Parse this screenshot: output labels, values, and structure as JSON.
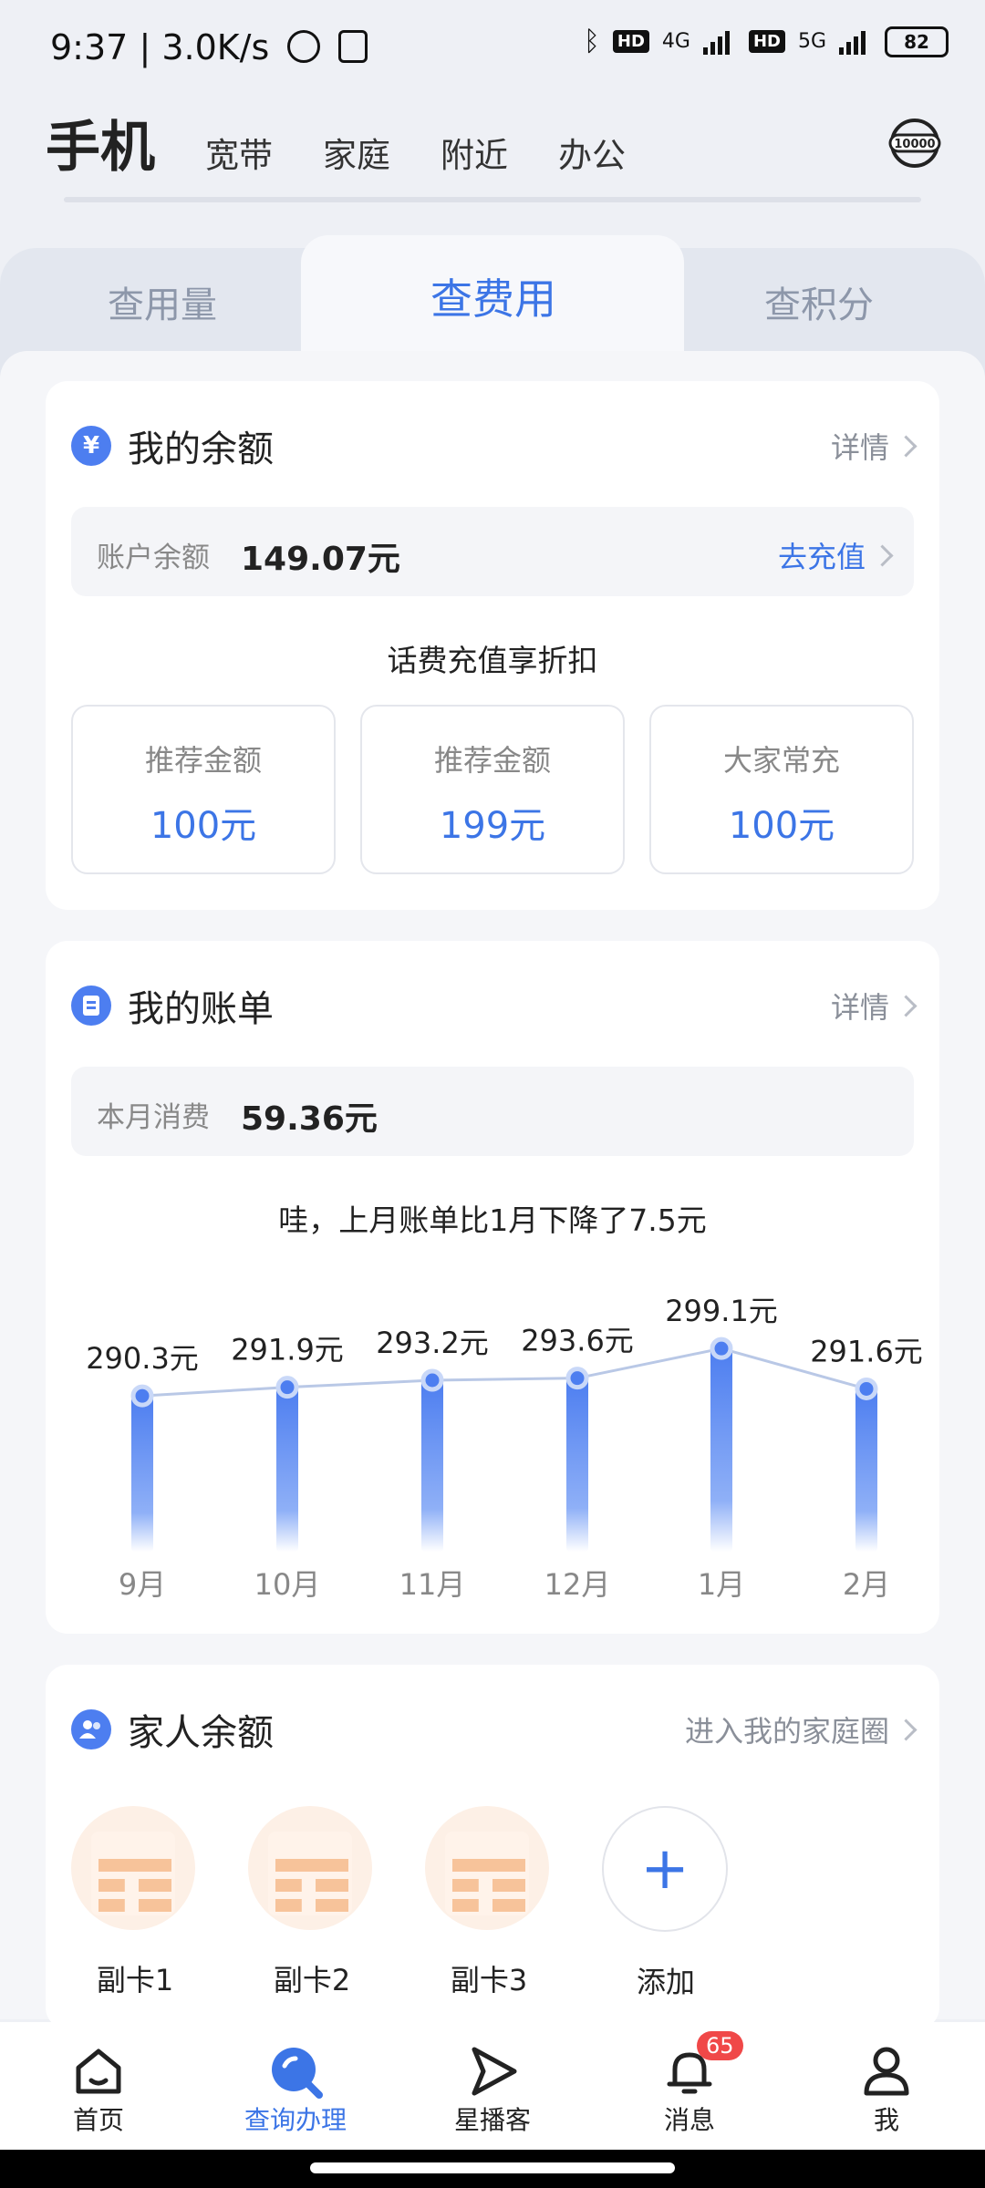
{
  "status_bar": {
    "time": "9:37",
    "speed": "3.0K/s",
    "network_4g": "4G",
    "network_5g": "5G",
    "hd": "HD",
    "battery": "82"
  },
  "top_nav": {
    "items": [
      "手机",
      "宽带",
      "家庭",
      "附近",
      "办公"
    ],
    "hotline_icon": "10000-service-icon"
  },
  "tabs": {
    "items": [
      "查用量",
      "查费用",
      "查积分"
    ],
    "active": "查费用"
  },
  "balance_card": {
    "title": "我的余额",
    "detail_label": "详情",
    "account_label": "账户余额",
    "account_value": "149.07元",
    "recharge_label": "去充值",
    "promo_text": "话费充值享折扣",
    "options": [
      {
        "title": "推荐金额",
        "value": "100元"
      },
      {
        "title": "推荐金额",
        "value": "199元"
      },
      {
        "title": "大家常充",
        "value": "100元"
      }
    ]
  },
  "bill_card": {
    "title": "我的账单",
    "detail_label": "详情",
    "month_label": "本月消费",
    "month_value": "59.36元",
    "summary": "哇，上月账单比1月下降了7.5元"
  },
  "chart_data": {
    "type": "bar",
    "categories": [
      "9月",
      "10月",
      "11月",
      "12月",
      "1月",
      "2月"
    ],
    "values": [
      290.3,
      291.9,
      293.2,
      293.6,
      299.1,
      291.6
    ],
    "value_labels": [
      "290.3元",
      "291.9元",
      "293.2元",
      "293.6元",
      "299.1元",
      "291.6元"
    ],
    "title": "",
    "xlabel": "",
    "ylabel": "",
    "grid": false,
    "bar_color": "#4d7ef0"
  },
  "family_card": {
    "title": "家人余额",
    "link_label": "进入我的家庭圈",
    "members": [
      "副卡1",
      "副卡2",
      "副卡3"
    ],
    "add_label": "添加"
  },
  "bottom_nav": {
    "items": [
      {
        "label": "首页",
        "icon": "home-icon"
      },
      {
        "label": "查询办理",
        "icon": "search-icon"
      },
      {
        "label": "星播客",
        "icon": "play-icon"
      },
      {
        "label": "消息",
        "icon": "bell-icon",
        "badge": "65"
      },
      {
        "label": "我",
        "icon": "user-icon"
      }
    ],
    "active": "查询办理"
  },
  "colors": {
    "accent": "#3c75e6",
    "badge": "#f04848",
    "avatar_orange": "#f7c39a"
  }
}
